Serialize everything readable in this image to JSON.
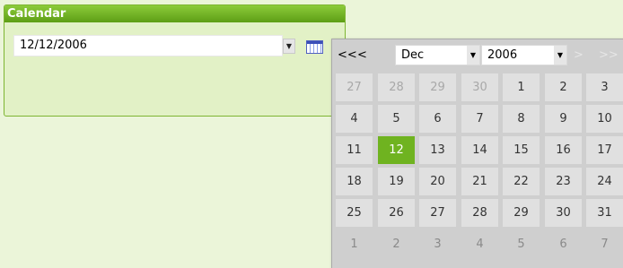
{
  "panel": {
    "title": "Calendar"
  },
  "date_input": {
    "value": "12/12/2006"
  },
  "popup": {
    "nav": {
      "prev_year": "<<",
      "prev_month": "<",
      "next_month": ">",
      "next_year": ">>"
    },
    "month_select": "Dec",
    "year_select": "2006",
    "weeks": [
      [
        "27",
        "28",
        "29",
        "30",
        "1",
        "2",
        "3"
      ],
      [
        "4",
        "5",
        "6",
        "7",
        "8",
        "9",
        "10"
      ],
      [
        "11",
        "12",
        "13",
        "14",
        "15",
        "16",
        "17"
      ],
      [
        "18",
        "19",
        "20",
        "21",
        "22",
        "23",
        "24"
      ],
      [
        "25",
        "26",
        "27",
        "28",
        "29",
        "30",
        "31"
      ],
      [
        "1",
        "2",
        "3",
        "4",
        "5",
        "6",
        "7"
      ]
    ],
    "selected_day": "12"
  },
  "colors": {
    "accent": "#6fb320",
    "panel_bg": "#e2f1c6",
    "header": "#5d9e15"
  },
  "icons": {
    "dropdown": "chevron-down-icon",
    "calendar": "calendar-icon"
  }
}
